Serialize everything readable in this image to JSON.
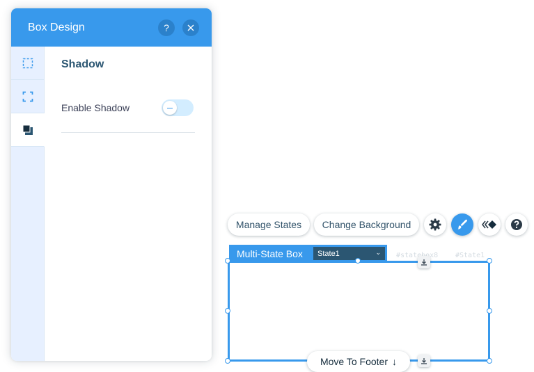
{
  "panel": {
    "title": "Box Design",
    "help_glyph": "?",
    "close_glyph": "✕",
    "tabs": [
      {
        "icon": "fill-corners-icon",
        "active": false
      },
      {
        "icon": "border-corners-icon",
        "active": false
      },
      {
        "icon": "shadow-icon",
        "active": true
      }
    ],
    "section_title": "Shadow",
    "enable_shadow_label": "Enable Shadow",
    "enable_shadow_on": false
  },
  "toolbar": {
    "manage_states": "Manage States",
    "change_background": "Change Background",
    "icons": [
      "settings-gear-icon",
      "design-brush-icon",
      "animation-icon",
      "help-icon"
    ],
    "accent": "#3899ec"
  },
  "element": {
    "label": "Multi-State Box",
    "selected_state": "State1",
    "ghost_id_1": "#statebox8",
    "ghost_id_2": "#State1",
    "move_to_footer": "Move To Footer",
    "move_arrow": "↓"
  },
  "colors": {
    "header_blue": "#3899ec",
    "dark_blue": "#2b5672",
    "tab_bg": "#e7f0ff"
  }
}
